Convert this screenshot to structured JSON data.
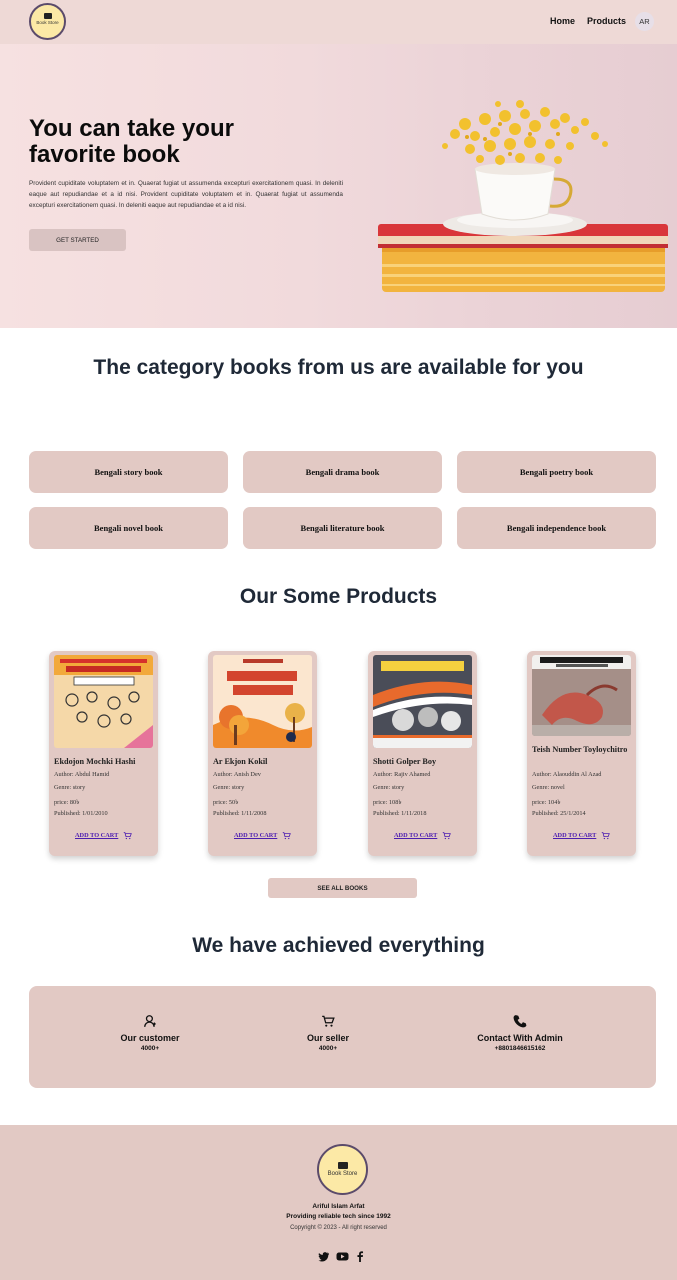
{
  "brand": {
    "logo_text": "Book Store"
  },
  "nav": {
    "home": "Home",
    "products": "Products",
    "avatar": "AR"
  },
  "hero": {
    "title": "You can take your favorite book",
    "text": "Provident cupiditate voluptatem et in. Quaerat fugiat ut assumenda excepturi exercitationem quasi. In deleniti eaque aut repudiandae et a id nisi. Provident cupiditate voluptatem et in. Quaerat fugiat ut assumenda excepturi exercitationem quasi. In deleniti eaque aut repudiandae et a id nisi.",
    "button": "GET STARTED"
  },
  "categories": {
    "title": "The category books from us are available for you",
    "items": [
      "Bengali story book",
      "Bengali drama book",
      "Bengali poetry book",
      "Bengali novel book",
      "Bengali literature book",
      "Bengali independence book"
    ]
  },
  "products": {
    "title": "Our Some Products",
    "items": [
      {
        "name": "Ekdojon Mochki Hashi",
        "author": "Author: Abdul Hamid",
        "genre": "Genre: story",
        "price": "price: 80৳",
        "published": "Published: 1/01/2010",
        "cart": "ADD TO CART"
      },
      {
        "name": "Ar Ekjon Kokil",
        "author": "Author: Anish Dev",
        "genre": "Genre: story",
        "price": "price: 50৳",
        "published": "Published: 1/11/2008",
        "cart": "ADD TO CART"
      },
      {
        "name": "Shotti Golper Boy",
        "author": "Author: Rajiv Ahamed",
        "genre": "Genre: story",
        "price": "price: 108৳",
        "published": "Published: 1/11/2018",
        "cart": "ADD TO CART"
      },
      {
        "name": "Teish Number Toyloychitro",
        "author": "Author: Alaouddin Al Azad",
        "genre": "Genre: novel",
        "price": "price: 104৳",
        "published": "Published: 25/1/2014",
        "cart": "ADD TO CART"
      }
    ],
    "see_all": "SEE ALL BOOKS"
  },
  "achieved": {
    "title": "We have achieved everything",
    "items": [
      {
        "icon": "user-icon",
        "label": "Our customer",
        "value": "4000+"
      },
      {
        "icon": "cart-icon",
        "label": "Our seller",
        "value": "4000+"
      },
      {
        "icon": "phone-icon",
        "label": "Contact With Admin",
        "value": "+8801846615162"
      }
    ]
  },
  "footer": {
    "logo_text": "Book Store",
    "name": "Ariful Islam Arfat",
    "tagline": "Providing reliable tech since 1992",
    "copyright": "Copyright © 2023 - All right reserved",
    "social": [
      "twitter-icon",
      "youtube-icon",
      "facebook-icon"
    ]
  },
  "colors": {
    "card": "#e2c9c4",
    "navbar": "#eed9d6",
    "link": "#4c1db1"
  }
}
